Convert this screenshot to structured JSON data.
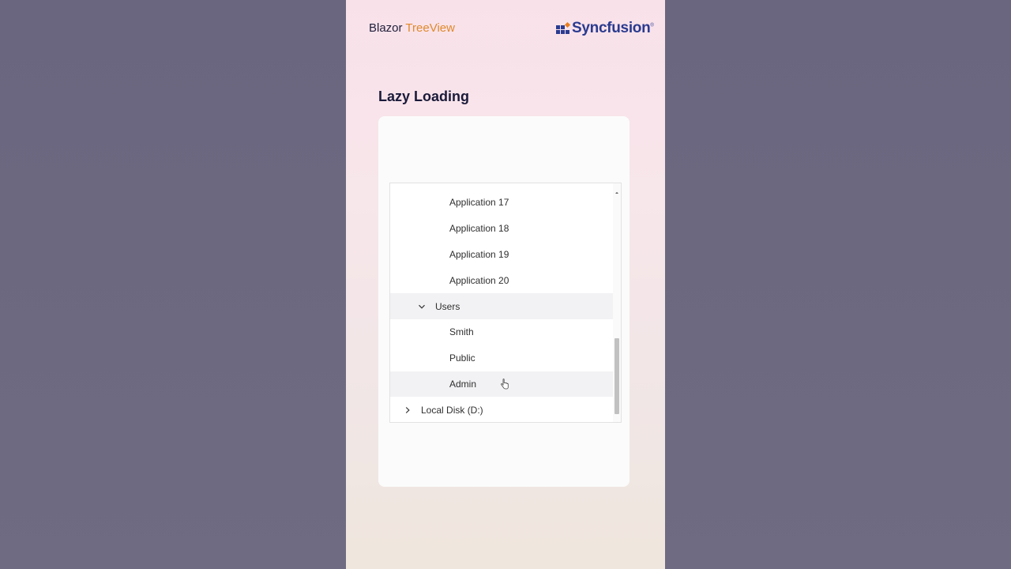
{
  "header": {
    "brand_prefix": "Blazor ",
    "brand_accent": "TreeView",
    "logo_text": "Syncfusion",
    "logo_mark": "®",
    "accent_color": "#e08a2c",
    "logo_color": "#2a3b8f"
  },
  "section": {
    "title": "Lazy Loading"
  },
  "tree": {
    "nodes": [
      {
        "label": "Application 17",
        "level": 3
      },
      {
        "label": "Application 18",
        "level": 3
      },
      {
        "label": "Application 19",
        "level": 3
      },
      {
        "label": "Application 20",
        "level": 3
      },
      {
        "label": "Users",
        "level": 2,
        "expanded": true,
        "icon": "chevron-down-icon"
      },
      {
        "label": "Smith",
        "level": 3
      },
      {
        "label": "Public",
        "level": 3
      },
      {
        "label": "Admin",
        "level": 3,
        "hovered": true
      },
      {
        "label": "Local Disk (D:)",
        "level": 1,
        "expanded": false,
        "icon": "chevron-right-icon"
      }
    ]
  }
}
